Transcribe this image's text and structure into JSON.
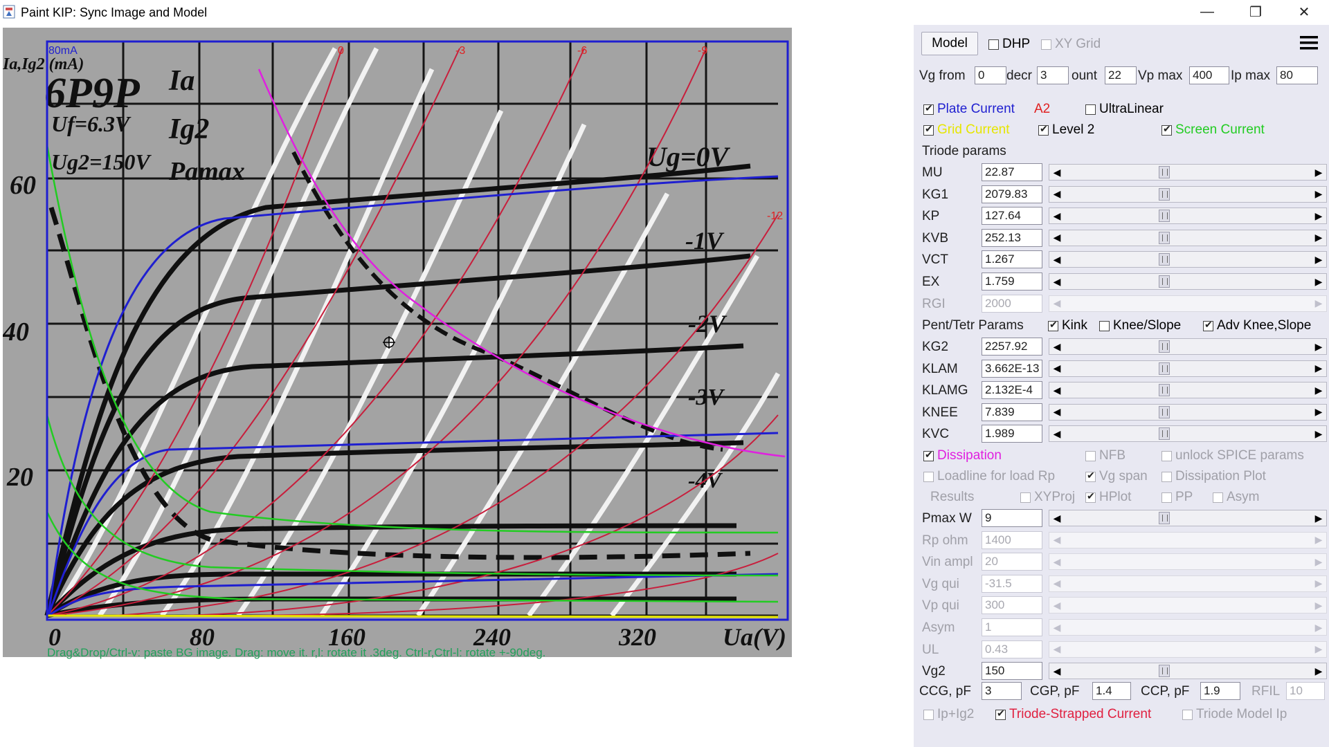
{
  "window": {
    "title": "Paint KIP: Sync Image and Model",
    "minimize": "—",
    "restore": "❐",
    "close": "✕"
  },
  "plot": {
    "tube_name": "6P9P",
    "legend": [
      "Ia",
      "Ig2",
      "Pamax"
    ],
    "conditions": [
      "Uf=6.3V",
      "Ug2=150V"
    ],
    "y_axis_label": "Ia,Ig2 (mA)",
    "x_axis_label": "Ua(V)",
    "y_ticks": [
      "60",
      "40",
      "20"
    ],
    "x_ticks": [
      "0",
      "80",
      "160",
      "240",
      "320"
    ],
    "curve_labels": [
      "Ug=0V",
      "-1V",
      "-2V",
      "-3V",
      "-4V"
    ],
    "top_scale": "80mA",
    "grid_labels_top": [
      "0",
      "-3",
      "-6",
      "-9"
    ],
    "grid_label_right": "-12",
    "hint": "Drag&Drop/Ctrl-v: paste BG image. Drag: move it. r,l: rotate it .3deg. Ctrl-r,Ctrl-l: rotate +-90deg."
  },
  "panel": {
    "model_button": "Model",
    "dhp": "DHP",
    "xy_grid": "XY Grid",
    "vg_from_label": "Vg from",
    "vg_from": "0",
    "decr_label": "decr",
    "decr": "3",
    "count_label": "ount",
    "count": "22",
    "vp_max_label": "Vp max",
    "vp_max": "400",
    "ip_max_label": "Ip max",
    "ip_max": "80",
    "plate_current": "Plate Current",
    "a2": "A2",
    "ultralinear": "UltraLinear",
    "grid_current": "Grid Current",
    "level2": "Level 2",
    "screen_current": "Screen Current",
    "triode_params": "Triode params",
    "params": [
      {
        "name": "MU",
        "value": "22.87"
      },
      {
        "name": "KG1",
        "value": "2079.83"
      },
      {
        "name": "KP",
        "value": "127.64"
      },
      {
        "name": "KVB",
        "value": "252.13"
      },
      {
        "name": "VCT",
        "value": "1.267"
      },
      {
        "name": "EX",
        "value": "1.759"
      },
      {
        "name": "RGI",
        "value": "2000"
      }
    ],
    "pent_tetr_params": "Pent/Tetr Params",
    "kink": "Kink",
    "knee_slope": "Knee/Slope",
    "adv_knee_slope": "Adv Knee,Slope",
    "pent_params": [
      {
        "name": "KG2",
        "value": "2257.92"
      },
      {
        "name": "KLAM",
        "value": "3.662E-13"
      },
      {
        "name": "KLAMG",
        "value": "2.132E-4"
      },
      {
        "name": "KNEE",
        "value": "7.839"
      },
      {
        "name": "KVC",
        "value": "1.989"
      }
    ],
    "dissipation": "Dissipation",
    "nfb": "NFB",
    "unlock_spice": "unlock SPICE params",
    "loadline": "Loadline for load Rp",
    "vg_span": "Vg span",
    "dissipation_plot": "Dissipation Plot",
    "results": "Results",
    "xyproj": "XYProj",
    "hplot": "HPlot",
    "pp": "PP",
    "asym_cb": "Asym",
    "load_params": [
      {
        "name": "Pmax W",
        "value": "9"
      },
      {
        "name": "Rp ohm",
        "value": "1400"
      },
      {
        "name": "Vin ampl",
        "value": "20"
      },
      {
        "name": "Vg qui",
        "value": "-31.5"
      },
      {
        "name": "Vp qui",
        "value": "300"
      },
      {
        "name": "Asym",
        "value": "1"
      },
      {
        "name": "UL",
        "value": "0.43"
      },
      {
        "name": "Vg2",
        "value": "150"
      }
    ],
    "ccg_label": "CCG, pF",
    "ccg": "3",
    "cgp_label": "CGP, pF",
    "cgp": "1.4",
    "ccp_label": "CCP, pF",
    "ccp": "1.9",
    "rfil_label": "RFIL",
    "rfil": "10",
    "ip_ig2": "Ip+Ig2",
    "triode_strapped": "Triode-Strapped Current",
    "triode_model_ip": "Triode Model Ip"
  },
  "colors": {
    "plate": "#1f1fd0",
    "grid": "#e6e600",
    "screen": "#22cc22",
    "dissipation": "#e020e0",
    "a2": "#e02020",
    "loadlines": "#c81e3c",
    "hint": "#22a05a"
  }
}
